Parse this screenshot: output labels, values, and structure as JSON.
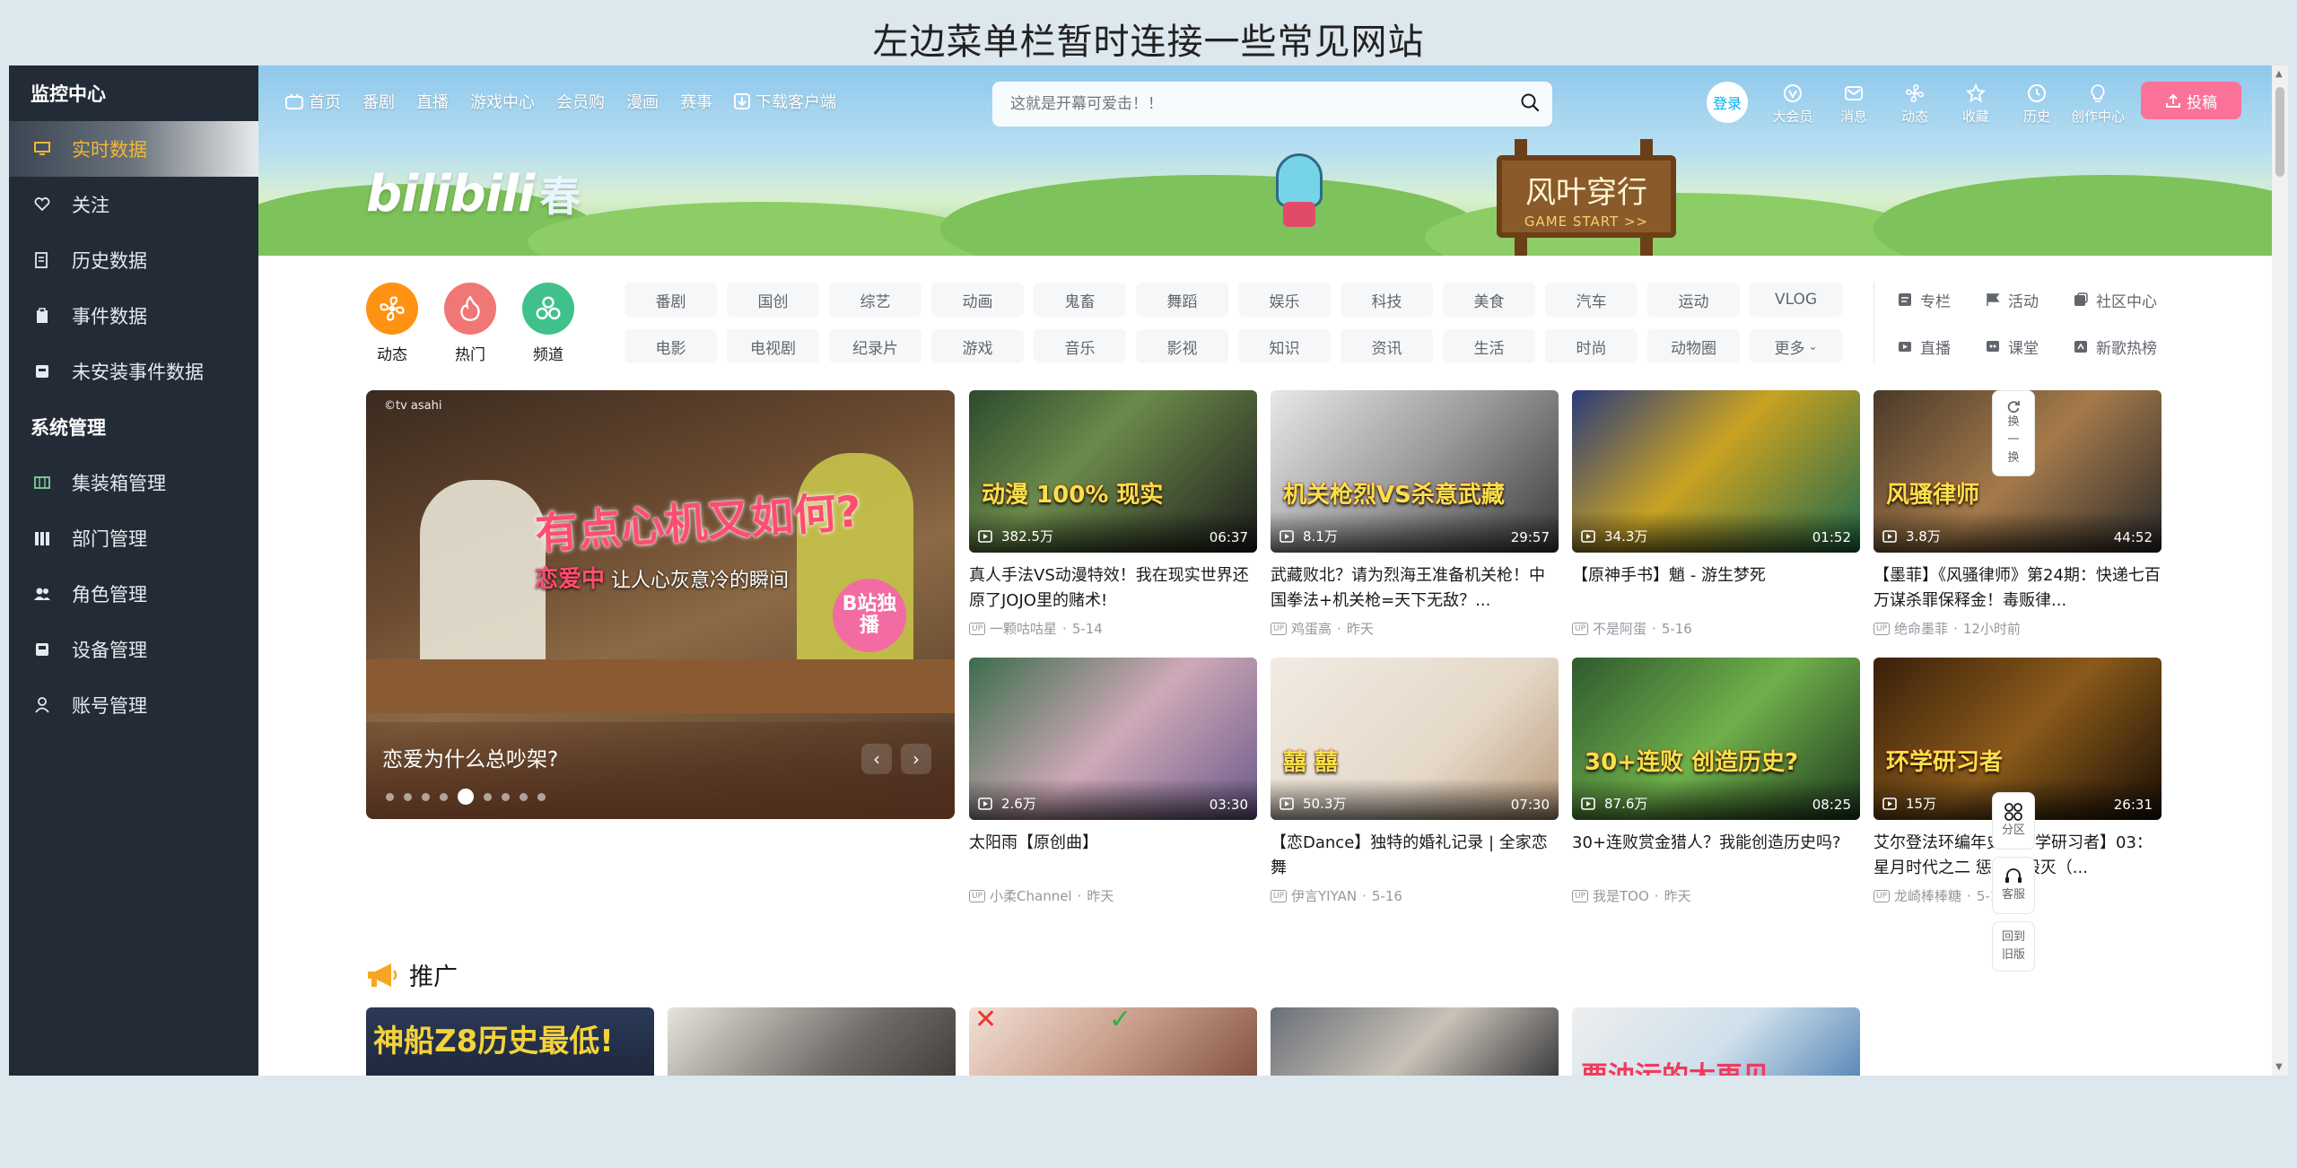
{
  "page_title": "左边菜单栏暂时连接一些常见网站",
  "sidebar": {
    "sections": [
      {
        "title": "监控中心",
        "items": [
          {
            "label": "实时数据",
            "icon": "monitor-icon",
            "active": true
          },
          {
            "label": "关注",
            "icon": "heart-icon"
          },
          {
            "label": "历史数据",
            "icon": "history-doc-icon"
          },
          {
            "label": "事件数据",
            "icon": "clipboard-icon"
          },
          {
            "label": "未安装事件数据",
            "icon": "uninstalled-icon"
          }
        ]
      },
      {
        "title": "系统管理",
        "items": [
          {
            "label": "集装箱管理",
            "icon": "container-icon"
          },
          {
            "label": "部门管理",
            "icon": "department-icon"
          },
          {
            "label": "角色管理",
            "icon": "role-icon"
          },
          {
            "label": "设备管理",
            "icon": "device-icon"
          },
          {
            "label": "账号管理",
            "icon": "account-icon"
          }
        ]
      }
    ]
  },
  "nav": {
    "left": [
      "首页",
      "番剧",
      "直播",
      "游戏中心",
      "会员购",
      "漫画",
      "赛事",
      "下载客户端"
    ],
    "search_placeholder": "这就是开幕可爱击！！",
    "login": "登录",
    "right": [
      "大会员",
      "消息",
      "动态",
      "收藏",
      "历史",
      "创作中心"
    ],
    "upload": "投稿"
  },
  "banner": {
    "logo": "bilibili",
    "logo_suffix": "春",
    "sign_title": "风叶穿行",
    "sign_sub": "GAME START >>"
  },
  "quick": [
    {
      "label": "动态",
      "color": "#ff9212"
    },
    {
      "label": "热门",
      "color": "#f07775"
    },
    {
      "label": "频道",
      "color": "#40c18b"
    }
  ],
  "channels": [
    "番剧",
    "国创",
    "综艺",
    "动画",
    "鬼畜",
    "舞蹈",
    "娱乐",
    "科技",
    "美食",
    "汽车",
    "运动",
    "VLOG",
    "电影",
    "电视剧",
    "纪录片",
    "游戏",
    "音乐",
    "影视",
    "知识",
    "资讯",
    "生活",
    "时尚",
    "动物圈",
    "更多"
  ],
  "extras": [
    "专栏",
    "活动",
    "社区中心",
    "直播",
    "课堂",
    "新歌热榜"
  ],
  "carousel": {
    "watermark": "©tv asahi",
    "headline": "有点心机又如何?",
    "sub_prefix": "恋爱中",
    "sub_text": "让人心灰意冷的瞬间",
    "badge": "B站独播",
    "title": "恋爱为什么总吵架?",
    "dots_total": 9,
    "dots_active": 4
  },
  "videos": [
    {
      "views": "382.5万",
      "dur": "06:37",
      "title": "真人手法VS动漫特效！我在现实世界还原了JOJO里的赌术!",
      "author": "一颗咕咕星",
      "date": "5-14",
      "overlay": "动漫 100% 现实",
      "bg": "linear-gradient(135deg,#2c4a2e,#6b8a4a 40%,#1d1d1d)"
    },
    {
      "views": "8.1万",
      "dur": "29:57",
      "title": "武藏败北？请为烈海王准备机关枪！中国拳法+机关枪=天下无敌？...",
      "author": "鸡蛋高",
      "date": "昨天",
      "overlay": "机关枪烈VS杀意武藏",
      "bg": "linear-gradient(135deg,#e8e8e8,#9a9a9a 50%,#3a3a3a)"
    },
    {
      "views": "34.3万",
      "dur": "01:52",
      "title": "【原神手书】魈 - 游生梦死",
      "author": "不是阿蛋",
      "date": "5-16",
      "overlay": "",
      "bg": "linear-gradient(135deg,#2a3b7a,#c9a223 45%,#1e6a4a)"
    },
    {
      "views": "3.8万",
      "dur": "44:52",
      "title": "【墨菲】《风骚律师》第24期：快递七百万谋杀罪保释金！毒贩律...",
      "author": "绝命墨菲",
      "date": "12小时前",
      "overlay": "风骚律师",
      "bg": "linear-gradient(135deg,#4a3a2a,#a57a4a 50%,#2a2a2a)"
    },
    {
      "views": "2.6万",
      "dur": "03:30",
      "title": "太阳雨【原创曲】",
      "author": "小柔Channel",
      "date": "昨天",
      "overlay": "",
      "bg": "linear-gradient(135deg,#3b6d4a,#cfa9b8 50%,#6a5a8a)"
    },
    {
      "views": "50.3万",
      "dur": "07:30",
      "title": "【恋Dance】独特的婚礼记录 | 全家恋舞",
      "author": "伊言YIYAN",
      "date": "5-16",
      "overlay": "囍 囍",
      "bg": "linear-gradient(135deg,#f1ebe3,#e5d8c8 60%,#b89a7a)"
    },
    {
      "views": "87.6万",
      "dur": "08:25",
      "title": "30+连败赏金猎人？我能创造历史吗?",
      "author": "我是TOO",
      "date": "昨天",
      "overlay": "30+连败 创造历史?",
      "bg": "linear-gradient(135deg,#2f5a2f,#6fb04a 50%,#1e3a1e)"
    },
    {
      "views": "15万",
      "dur": "26:31",
      "title": "艾尔登法环编年史【环学研习者】03：星月时代之二 惩罚与毁灭（...",
      "author": "龙崎棒棒糖",
      "date": "5-16",
      "overlay": "环学研习者",
      "bg": "linear-gradient(135deg,#3a1f0a,#8a5a1a 50%,#1a0f05)"
    }
  ],
  "float_buttons": [
    "换一换",
    "分区",
    "客服",
    "回到旧版"
  ],
  "promo": {
    "title": "推广",
    "thumb_overlay": "神船Z8历史最低!",
    "thumb_overlay_2": "要油污的太再见"
  },
  "colors": {
    "accent": "#00aeec",
    "pink": "#fb7299",
    "sidebar_bg": "#232c36",
    "active_text": "#f2b733"
  }
}
